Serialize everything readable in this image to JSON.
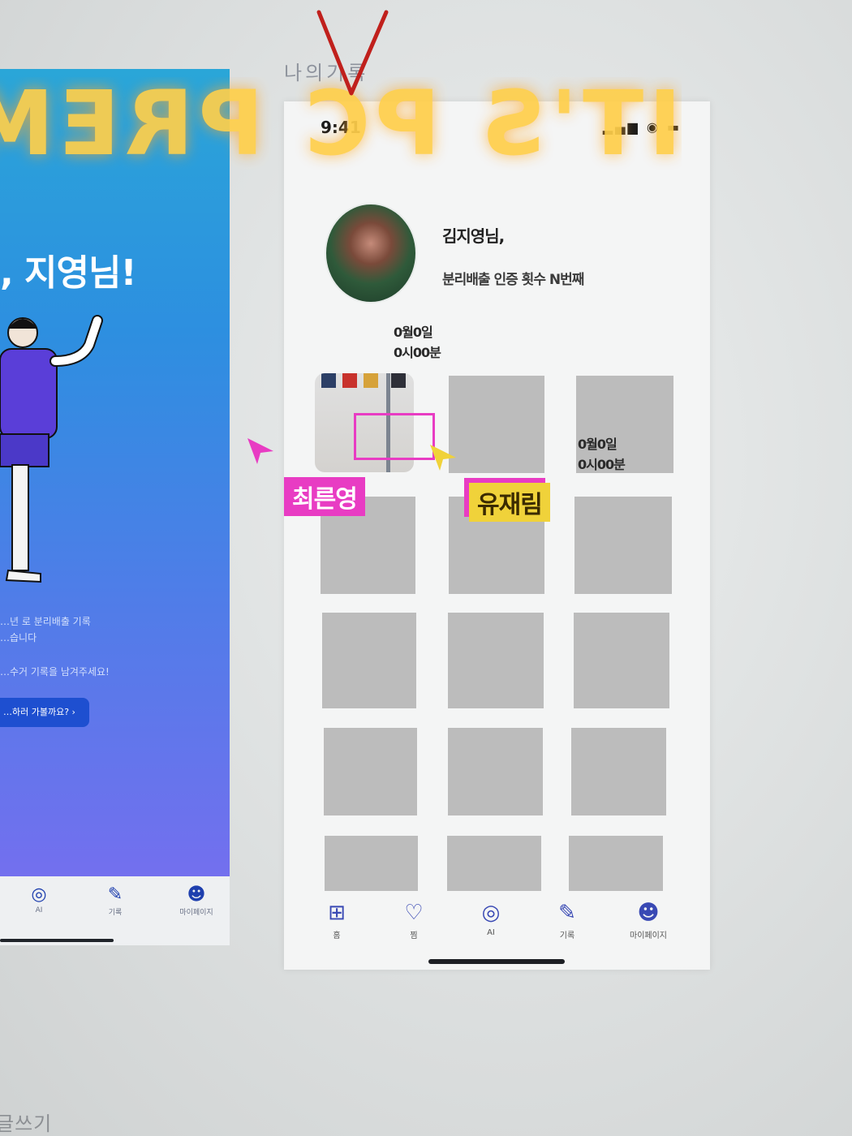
{
  "banner": {
    "text": "IT'S PC PREMIUM"
  },
  "page_title": "나의기록",
  "left_screen": {
    "greeting": ", 지영님!",
    "desc_line1": "…년 로 분리배출 기록",
    "desc_line2": "…습니다",
    "desc_line3": "…수거 기록을 남겨주세요!",
    "cta": "…하러 가볼까요? ›",
    "tabs": [
      "AI",
      "기록",
      "마이페이지"
    ]
  },
  "phone": {
    "status_time": "9:41",
    "status_icons": "▂▄▆ ◉ ▬",
    "profile": {
      "name": "김지영님,",
      "subtitle": "분리배출 인증 횟수 N번째"
    },
    "date_label_1": [
      "0월0일",
      "0시00분"
    ],
    "date_label_2": [
      "0월0일",
      "0시00분"
    ],
    "tabs": [
      {
        "icon": "grid-icon",
        "glyph": "⊞",
        "label": "홈"
      },
      {
        "icon": "heart-icon",
        "glyph": "♡",
        "label": "찜"
      },
      {
        "icon": "ai-icon",
        "glyph": "◎",
        "label": "AI"
      },
      {
        "icon": "record-icon",
        "glyph": "✎",
        "label": "기록"
      },
      {
        "icon": "mypage-icon",
        "glyph": "☻",
        "label": "마이페이지"
      }
    ]
  },
  "cursors": [
    {
      "label": "최른영",
      "color": "#e83cc3"
    },
    {
      "label": "유재림",
      "color": "#f0d23a"
    }
  ],
  "footer_text": "글쓰기",
  "colors": {
    "accent": "#3949b4",
    "cursor_pink": "#e83cc3",
    "cursor_yellow": "#f0d23a",
    "banner": "#ffcf4a",
    "placeholder_gray": "#bcbcbc"
  }
}
